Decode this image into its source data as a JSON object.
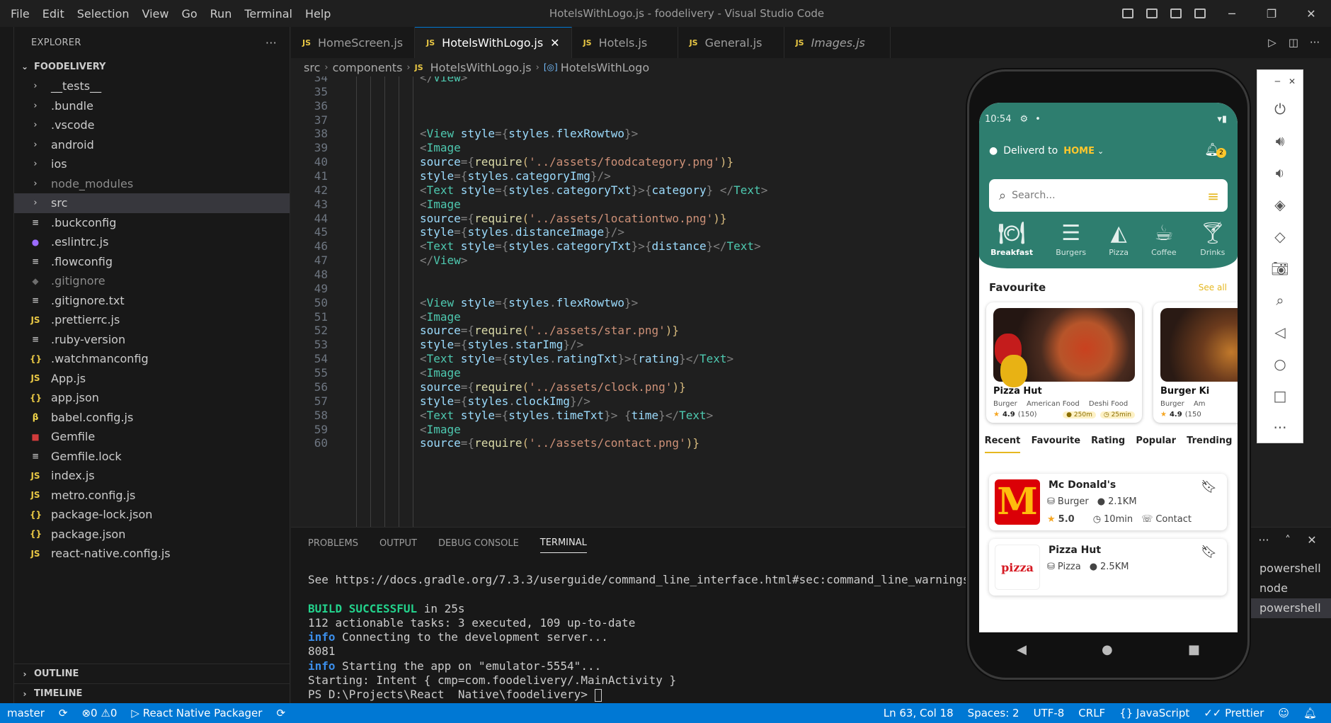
{
  "menu": [
    "File",
    "Edit",
    "Selection",
    "View",
    "Go",
    "Run",
    "Terminal",
    "Help"
  ],
  "window_title": "HotelsWithLogo.js - foodelivery - Visual Studio Code",
  "window_controls": {
    "minimize": "─",
    "restore": "❐",
    "close": "✕"
  },
  "explorer": {
    "title": "EXPLORER",
    "more": "···",
    "project": "FOODELIVERY",
    "items": [
      {
        "name": "__tests__",
        "type": "folder"
      },
      {
        "name": ".bundle",
        "type": "folder"
      },
      {
        "name": ".vscode",
        "type": "folder"
      },
      {
        "name": "android",
        "type": "folder"
      },
      {
        "name": "ios",
        "type": "folder"
      },
      {
        "name": "node_modules",
        "type": "folder"
      },
      {
        "name": "src",
        "type": "folder"
      },
      {
        "name": ".buckconfig",
        "icon": "≡"
      },
      {
        "name": ".eslintrc.js",
        "icon": "●"
      },
      {
        "name": ".flowconfig",
        "icon": "≡"
      },
      {
        "name": ".gitignore",
        "icon": "◆"
      },
      {
        "name": ".gitignore.txt",
        "icon": "≡"
      },
      {
        "name": ".prettierrc.js",
        "icon": "JS"
      },
      {
        "name": ".ruby-version",
        "icon": "≡"
      },
      {
        "name": ".watchmanconfig",
        "icon": "{}"
      },
      {
        "name": "App.js",
        "icon": "JS"
      },
      {
        "name": "app.json",
        "icon": "{}"
      },
      {
        "name": "babel.config.js",
        "icon": "β"
      },
      {
        "name": "Gemfile",
        "icon": "■"
      },
      {
        "name": "Gemfile.lock",
        "icon": "≡"
      },
      {
        "name": "index.js",
        "icon": "JS"
      },
      {
        "name": "metro.config.js",
        "icon": "JS"
      },
      {
        "name": "package-lock.json",
        "icon": "{}"
      },
      {
        "name": "package.json",
        "icon": "{}"
      },
      {
        "name": "react-native.config.js",
        "icon": "JS"
      }
    ],
    "outline": "OUTLINE",
    "timeline": "TIMELINE"
  },
  "tabs": [
    {
      "label": "HomeScreen.js",
      "badge": "JS"
    },
    {
      "label": "HotelsWithLogo.js",
      "badge": "JS",
      "close": "✕"
    },
    {
      "label": "Hotels.js",
      "badge": "JS"
    },
    {
      "label": "General.js",
      "badge": "JS"
    },
    {
      "label": "Images.js",
      "badge": "JS"
    }
  ],
  "breadcrumb": {
    "src": "src",
    "components": "components",
    "file": "HotelsWithLogo.js",
    "symbol": "HotelsWithLogo",
    "file_badge": "JS",
    "symbol_badge": "[◎]"
  },
  "code": {
    "l34": {
      "n": "34",
      "a": "</",
      "b": "View",
      "c": ">"
    },
    "l35": {
      "n": "35"
    },
    "l36": {
      "n": "36"
    },
    "l37": {
      "n": "37"
    },
    "l38": {
      "n": "38",
      "a": "<",
      "b": "View",
      "c": " style",
      "d": "={",
      "e": "styles",
      "f": ".",
      "g": "flexRowtwo",
      "h": "}>"
    },
    "l39": {
      "n": "39",
      "a": "<",
      "b": "Image"
    },
    "l40": {
      "n": "40",
      "a": "source",
      "b": "={",
      "c": "require",
      "d": "(",
      "e": "'../assets/foodcategory.png'",
      "f": ")}"
    },
    "l41": {
      "n": "41",
      "a": "style",
      "b": "={",
      "c": "styles",
      "d": ".",
      "e": "categoryImg",
      "f": "}/>"
    },
    "l42": {
      "n": "42",
      "a": "<",
      "b": "Text",
      "c": " style",
      "d": "={",
      "e": "styles",
      "f": ".",
      "g": "categoryTxt",
      "h": "}>",
      "i": "{",
      "j": "category",
      "k": "}",
      "l": " </",
      "m": "Text",
      "o": ">"
    },
    "l43": {
      "n": "43",
      "a": "<",
      "b": "Image"
    },
    "l44": {
      "n": "44",
      "a": "source",
      "b": "={",
      "c": "require",
      "d": "(",
      "e": "'../assets/locationtwo.png'",
      "f": ")}"
    },
    "l45": {
      "n": "45",
      "a": "style",
      "b": "={",
      "c": "styles",
      "d": ".",
      "e": "distanceImage",
      "f": "}/>"
    },
    "l46": {
      "n": "46",
      "a": "<",
      "b": "Text",
      "c": " style",
      "d": "={",
      "e": "styles",
      "f": ".",
      "g": "categoryTxt",
      "h": "}>",
      "i": "{",
      "j": "distance",
      "k": "}",
      "l": "</",
      "m": "Text",
      "o": ">"
    },
    "l47": {
      "n": "47",
      "a": "</",
      "b": "View",
      "c": ">"
    },
    "l48": {
      "n": "48"
    },
    "l49": {
      "n": "49"
    },
    "l50": {
      "n": "50",
      "a": "<",
      "b": "View",
      "c": " style",
      "d": "={",
      "e": "styles",
      "f": ".",
      "g": "flexRowtwo",
      "h": "}>"
    },
    "l51": {
      "n": "51",
      "a": "<",
      "b": "Image"
    },
    "l52": {
      "n": "52",
      "a": "source",
      "b": "={",
      "c": "require",
      "d": "(",
      "e": "'../assets/star.png'",
      "f": ")}"
    },
    "l53": {
      "n": "53",
      "a": "style",
      "b": "={",
      "c": "styles",
      "d": ".",
      "e": "starImg",
      "f": "}/>"
    },
    "l54": {
      "n": "54",
      "a": "<",
      "b": "Text",
      "c": " style",
      "d": "={",
      "e": "styles",
      "f": ".",
      "g": "ratingTxt",
      "h": "}>",
      "i": "{",
      "j": "rating",
      "k": "}",
      "l": "</",
      "m": "Text",
      "o": ">"
    },
    "l55": {
      "n": "55",
      "a": "<",
      "b": "Image"
    },
    "l56": {
      "n": "56",
      "a": "source",
      "b": "={",
      "c": "require",
      "d": "(",
      "e": "'../assets/clock.png'",
      "f": ")}"
    },
    "l57": {
      "n": "57",
      "a": "style",
      "b": "={",
      "c": "styles",
      "d": ".",
      "e": "clockImg",
      "f": "}/>"
    },
    "l58": {
      "n": "58",
      "a": "<",
      "b": "Text",
      "c": " style",
      "d": "={",
      "e": "styles",
      "f": ".",
      "g": "timeTxt",
      "h": "}>",
      "i": " {",
      "j": "time",
      "k": "}",
      "l": "</",
      "m": "Text",
      "o": ">"
    },
    "l59": {
      "n": "59",
      "a": "<",
      "b": "Image"
    },
    "l60": {
      "n": "60",
      "a": "source",
      "b": "={",
      "c": "require",
      "d": "(",
      "e": "'../assets/contact.png'",
      "f": ")}"
    }
  },
  "panel": {
    "tabs": [
      "PROBLEMS",
      "OUTPUT",
      "DEBUG CONSOLE",
      "TERMINAL"
    ],
    "actions": {
      "more": "···",
      "maximize": "˄",
      "close": "✕"
    },
    "terminal": {
      "see": "See https://docs.gradle.org/7.3.3/userguide/command_line_interface.html#sec:command_line_warnings",
      "build_ok": "BUILD SUCCESSFUL",
      "build_rest": " in 25s",
      "tasks": "112 actionable tasks: 3 executed, 109 up-to-date",
      "info1_tag": "info",
      "info1": " Connecting to the development server...",
      "port": "8081",
      "info2_tag": "info",
      "info2": " Starting the app on \"emulator-5554\"...",
      "starting": "Starting: Intent { cmp=com.foodelivery/.MainActivity }",
      "prompt": "PS D:\\Projects\\React  Native\\foodelivery> "
    },
    "terminal_list": [
      "powershell",
      "node",
      "powershell"
    ]
  },
  "statusbar": {
    "branch": "master",
    "sync": "⟳",
    "errors": "⊗0",
    "warnings": "⚠0",
    "packager": "▷ React Native Packager",
    "position": "Ln 63, Col 18",
    "spaces": "Spaces: 2",
    "encoding": "UTF-8",
    "eol": "CRLF",
    "language": "{} JavaScript",
    "prettier": "✓✓ Prettier"
  },
  "phone": {
    "time": "10:54",
    "deliver_label": "Deliverd to",
    "deliver_place": "HOME",
    "notif_count": "2",
    "search_placeholder": "Search...",
    "categories": [
      "Breakfast",
      "Burgers",
      "Pizza",
      "Coffee",
      "Drinks"
    ],
    "favourite_title": "Favourite",
    "see_all": "See all",
    "cards": [
      {
        "name": "Pizza Hut",
        "tags": [
          "Burger",
          "American Food",
          "Deshi Food"
        ],
        "rating": "4.9",
        "count": "(150)",
        "distance": "250m",
        "time": "25min"
      },
      {
        "name": "Burger Ki",
        "tags": [
          "Burger",
          "Am"
        ],
        "rating": "4.9",
        "count": "(150"
      }
    ],
    "list_tabs": [
      "Recent",
      "Favourite",
      "Rating",
      "Popular",
      "Trending"
    ],
    "restaurants": [
      {
        "name": "Mc Donald's",
        "category": "Burger",
        "distance": "2.1KM",
        "rating": "5.0",
        "time": "10min",
        "contact": "Contact",
        "logo": "M"
      },
      {
        "name": "Pizza Hut",
        "category": "Pizza",
        "distance": "2.5KM",
        "logo": "pizza"
      }
    ]
  },
  "colors": {
    "accent": "#0078d4",
    "app_green": "#2e7e6f",
    "app_yellow": "#e6b820"
  }
}
